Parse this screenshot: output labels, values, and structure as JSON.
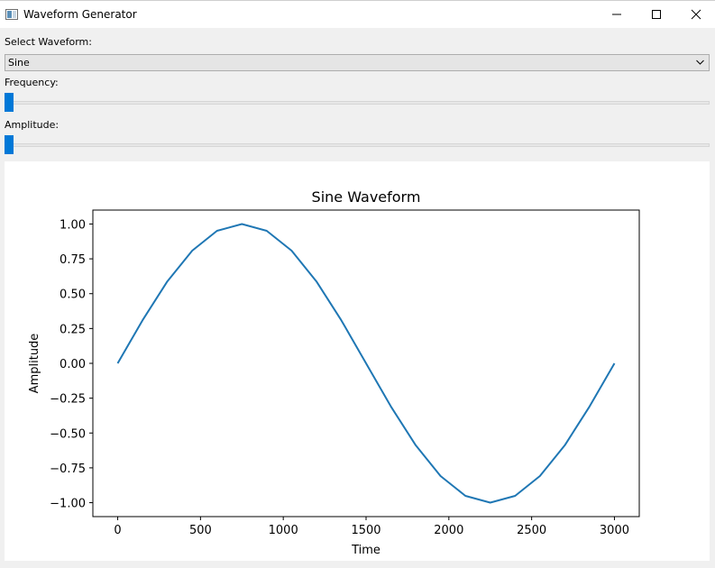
{
  "window": {
    "title": "Waveform Generator"
  },
  "controls": {
    "waveform_label": "Select Waveform:",
    "waveform_value": "Sine",
    "frequency_label": "Frequency:",
    "frequency_level": 0,
    "amplitude_label": "Amplitude:",
    "amplitude_level": 0,
    "accent_color": "#0078d7"
  },
  "chart_data": {
    "type": "line",
    "title": "Sine Waveform",
    "xlabel": "Time",
    "ylabel": "Amplitude",
    "xlim": [
      -150,
      3150
    ],
    "ylim": [
      -1.1,
      1.1
    ],
    "xticks": [
      0,
      500,
      1000,
      1500,
      2000,
      2500,
      3000
    ],
    "yticks": [
      1.0,
      0.75,
      0.5,
      0.25,
      0.0,
      -0.25,
      -0.5,
      -0.75,
      -1.0
    ],
    "ytick_labels": [
      "1.00",
      "0.75",
      "0.50",
      "0.25",
      "0.00",
      "−0.25",
      "−0.50",
      "−0.75",
      "−1.00"
    ],
    "grid": false,
    "series": [
      {
        "color": "#1f77b4",
        "x": [
          0,
          150,
          300,
          450,
          600,
          750,
          900,
          1050,
          1200,
          1350,
          1500,
          1650,
          1800,
          1950,
          2100,
          2250,
          2400,
          2550,
          2700,
          2850,
          3000
        ],
        "y": [
          0.0,
          0.309,
          0.588,
          0.809,
          0.951,
          1.0,
          0.951,
          0.809,
          0.588,
          0.309,
          0.0,
          -0.309,
          -0.588,
          -0.809,
          -0.951,
          -1.0,
          -0.951,
          -0.809,
          -0.588,
          -0.309,
          0.0
        ]
      }
    ]
  }
}
